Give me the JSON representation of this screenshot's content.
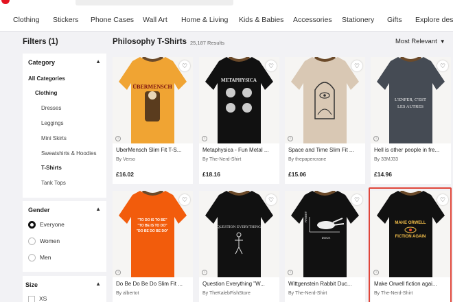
{
  "nav": {
    "categories": [
      "Clothing",
      "Stickers",
      "Phone Cases",
      "Wall Art",
      "Home & Living",
      "Kids & Babies",
      "Accessories",
      "Stationery",
      "Gifts",
      "Explore desig"
    ]
  },
  "sidebar": {
    "filters_title": "Filters (1)",
    "category": {
      "title": "Category",
      "items": [
        {
          "label": "All Categories",
          "bold": true
        },
        {
          "label": "Clothing",
          "bold": true
        },
        {
          "label": "Dresses",
          "bold": false
        },
        {
          "label": "Leggings",
          "bold": false
        },
        {
          "label": "Mini Skirts",
          "bold": false
        },
        {
          "label": "Sweatshirts & Hoodies",
          "bold": false
        },
        {
          "label": "T-Shirts",
          "bold": true
        },
        {
          "label": "Tank Tops",
          "bold": false
        }
      ]
    },
    "gender": {
      "title": "Gender",
      "options": [
        "Everyone",
        "Women",
        "Men"
      ],
      "selected": "Everyone"
    },
    "size": {
      "title": "Size",
      "options": [
        "XS"
      ]
    }
  },
  "main": {
    "title": "Philosophy T-Shirts",
    "results": "25,187 Results",
    "sort_label": "Most Relevant"
  },
  "products": [
    {
      "title": "UberMensch Slim Fit T-S...",
      "by": "By Verso",
      "price": "£16.02",
      "shirt_color": "#f0a433",
      "design": "ubermensch"
    },
    {
      "title": "Metaphysica - Fun Metal ...",
      "by": "By The-Nerd-Shirt",
      "price": "£18.16",
      "shirt_color": "#111111",
      "design": "metaphysica"
    },
    {
      "title": "Space and Time Slim Fit ...",
      "by": "By thepapercrane",
      "price": "£15.06",
      "shirt_color": "#d9c8b4",
      "design": "spacetime"
    },
    {
      "title": "Hell is other people in fre...",
      "by": "By 33MJ33",
      "price": "£14.96",
      "shirt_color": "#454b54",
      "design": "enfer"
    },
    {
      "title": "Do Be Do Be Do Slim Fit ...",
      "by": "By albertot",
      "price": "",
      "shirt_color": "#f25c0c",
      "design": "dobedo"
    },
    {
      "title": "Question Everything \"W...",
      "by": "By TheKalebFishStore",
      "price": "",
      "shirt_color": "#111111",
      "design": "question"
    },
    {
      "title": "Wittgenstein Rabbit Duc...",
      "by": "By The-Nerd-Shirt",
      "price": "",
      "shirt_color": "#111111",
      "design": "rabbit"
    },
    {
      "title": "Make Orwell fiction agai...",
      "by": "By The-Nerd-Shirt",
      "price": "",
      "shirt_color": "#111111",
      "design": "orwell"
    }
  ],
  "designs": {
    "ubermensch": "ÜBERMENSCH",
    "metaphysica": "METAPHYSICA",
    "enfer": [
      "L'ENFER, C'EST",
      "LES AUTRES"
    ],
    "dobedo": [
      "\"TO DO IS TO BE\"",
      "\"TO BE IS TO DO\"",
      "\"DO BE DO BE DO\""
    ],
    "question": "QUESTION EVERYTHING",
    "rabbit": [
      "RABBIT",
      "DUCK"
    ],
    "orwell": [
      "MAKE ORWELL",
      "FICTION AGAIN"
    ]
  },
  "colors": {
    "accent": "#e41321",
    "highlight": "#e0463a",
    "background": "#f2f2f5"
  },
  "icons": {
    "heart": "♡",
    "chevron_up": "⌃",
    "chevron_down": "⌄",
    "info": "i"
  }
}
